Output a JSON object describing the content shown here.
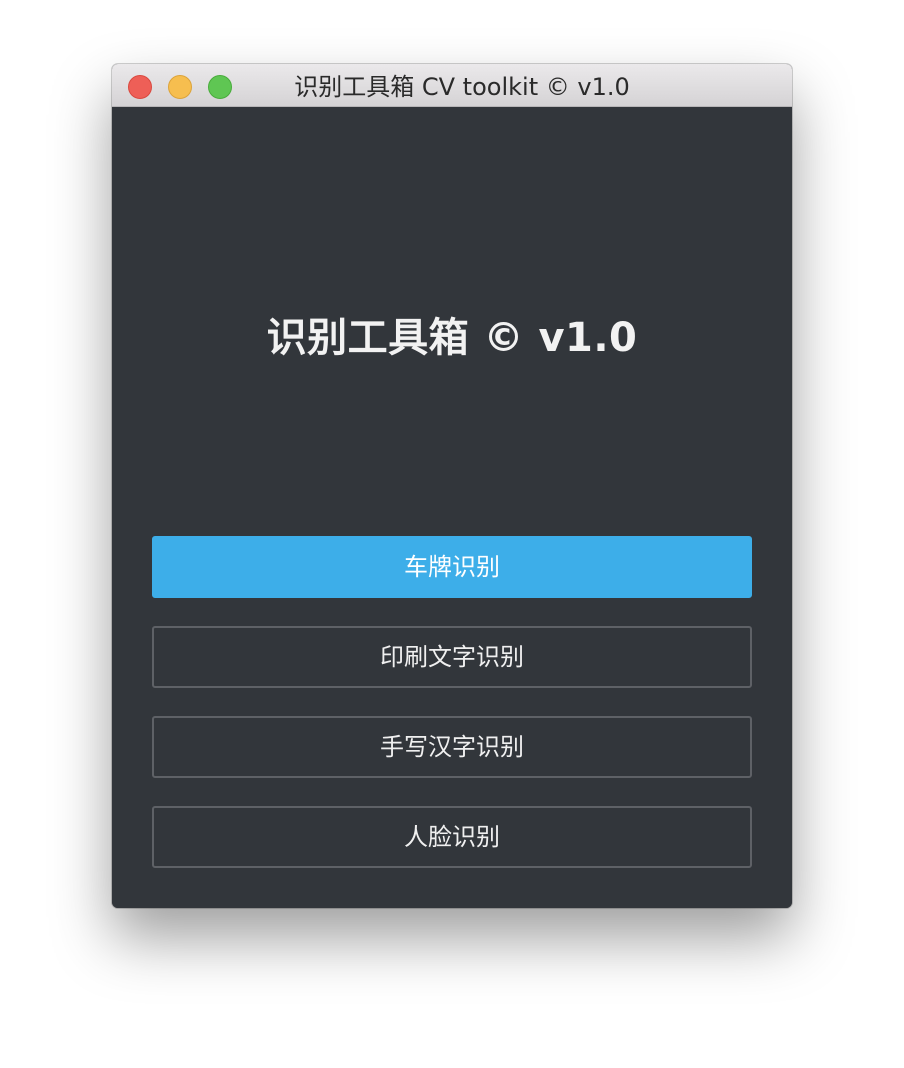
{
  "window": {
    "title": "识别工具箱 CV toolkit © v1.0"
  },
  "main": {
    "heading": "识别工具箱 © v1.0",
    "buttons": [
      {
        "label": "车牌识别",
        "style": "primary"
      },
      {
        "label": "印刷文字识别",
        "style": "outline"
      },
      {
        "label": "手写汉字识别",
        "style": "outline"
      },
      {
        "label": "人脸识别",
        "style": "outline"
      }
    ]
  },
  "colors": {
    "background": "#32363b",
    "accent": "#3daee9",
    "button_border": "#5e6166",
    "text": "#f2f2f2"
  }
}
